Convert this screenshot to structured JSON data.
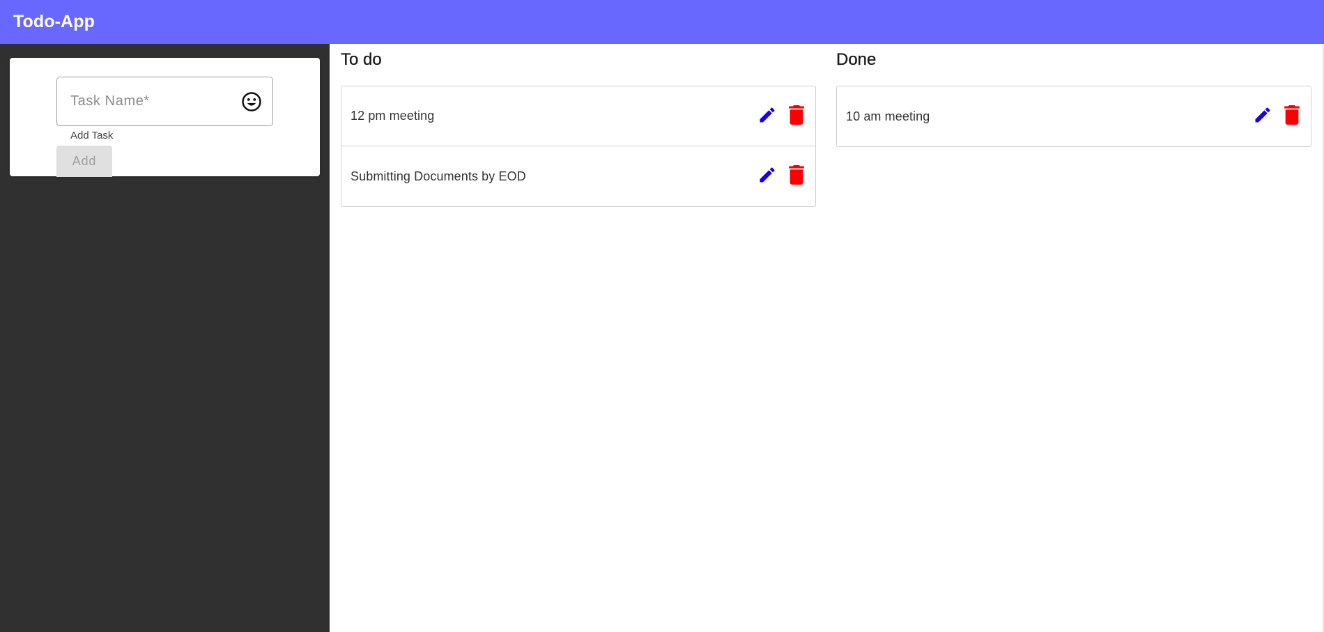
{
  "appbar": {
    "title": "Todo-App",
    "color": "#6868ff"
  },
  "add_form": {
    "task_field": {
      "placeholder": "Task Name*",
      "value": ""
    },
    "emoji_icon": "emoji-smile-icon",
    "helper_text": "Add Task",
    "add_button_label": "Add"
  },
  "columns": {
    "todo": {
      "title": "To do",
      "items": [
        {
          "text": "12 pm meeting",
          "edit_icon": "pencil-icon",
          "delete_icon": "trash-icon"
        },
        {
          "text": "Submitting Documents by EOD",
          "edit_icon": "pencil-icon",
          "delete_icon": "trash-icon"
        }
      ]
    },
    "done": {
      "title": "Done",
      "items": [
        {
          "text": "10 am meeting",
          "edit_icon": "pencil-icon",
          "delete_icon": "trash-icon"
        }
      ]
    }
  },
  "colors": {
    "sidebar": "#303030",
    "edit": "#1a00e6",
    "delete": "#ff0000"
  }
}
